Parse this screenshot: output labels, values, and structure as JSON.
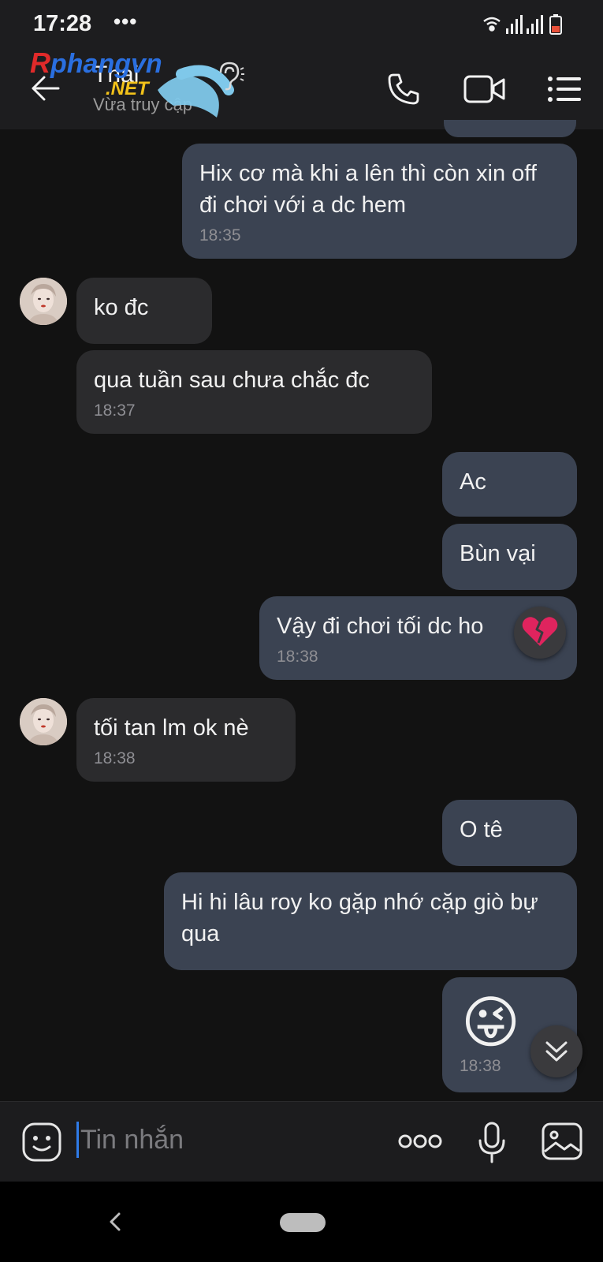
{
  "status_bar": {
    "time": "17:28",
    "more": "•••"
  },
  "header": {
    "contact_name": "Thai",
    "contact_status": "Vừa truy cập",
    "watermark_text": "Rphangvn .NET"
  },
  "messages": [
    {
      "text": "Hix cơ mà khi a lên thì còn xin off đi chơi với a dc hem",
      "time": "18:35"
    },
    {
      "text": "ko đc"
    },
    {
      "text": "qua tuần sau chưa chắc đc",
      "time": "18:37"
    },
    {
      "text": "Ac"
    },
    {
      "text": "Bùn vại"
    },
    {
      "text": "Vậy đi chơi tối dc ho",
      "time": "18:38",
      "reaction": "broken-heart"
    },
    {
      "text": "tối tan lm ok nè",
      "time": "18:38"
    },
    {
      "text": "O tê"
    },
    {
      "text": "Hi hi lâu roy ko gặp nhớ cặp giò bự qua"
    },
    {
      "text": "😜",
      "time": "18:38"
    }
  ],
  "composer": {
    "placeholder": "Tin nhắn"
  },
  "colors": {
    "outgoing_bubble": "#3b4352",
    "incoming_bubble": "#2b2b2d",
    "background": "#121212"
  }
}
